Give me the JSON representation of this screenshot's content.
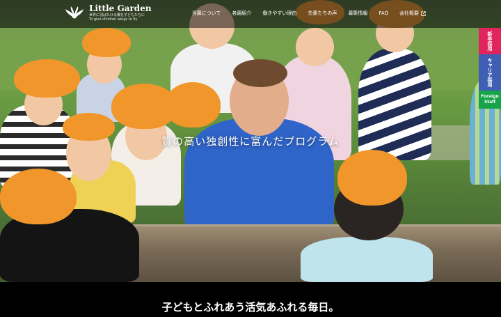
{
  "header": {
    "logo_title": "Little Garden",
    "logo_sub1": "世界に羽ばたける翼を子どもたちに",
    "logo_sub2": "To give children wings to fly"
  },
  "nav": {
    "items": [
      {
        "label": "当園について"
      },
      {
        "label": "各園紹介"
      },
      {
        "label": "働きやすい理由"
      },
      {
        "label": "先輩たちの声"
      },
      {
        "label": "募集情報"
      },
      {
        "label": "FAQ"
      },
      {
        "label": "会社概要"
      }
    ]
  },
  "side_tabs": {
    "new_grad": "新卒採用",
    "career": "キャリア採用",
    "foreign_line1": "Foreign",
    "foreign_line2": "Staff"
  },
  "hero": {
    "caption": "質の高い独創性に富んだプログラム"
  },
  "tagline": "子どもとふれあう活気あふれる毎日。",
  "colors": {
    "header_bg": "rgba(20,20,20,0.55)",
    "pink": "#e0245e",
    "blue": "#3f5fb5",
    "green": "#16a34a",
    "hat_orange": "#f0962a"
  },
  "icons": [
    "logo-mark-icon",
    "external-link-icon"
  ]
}
